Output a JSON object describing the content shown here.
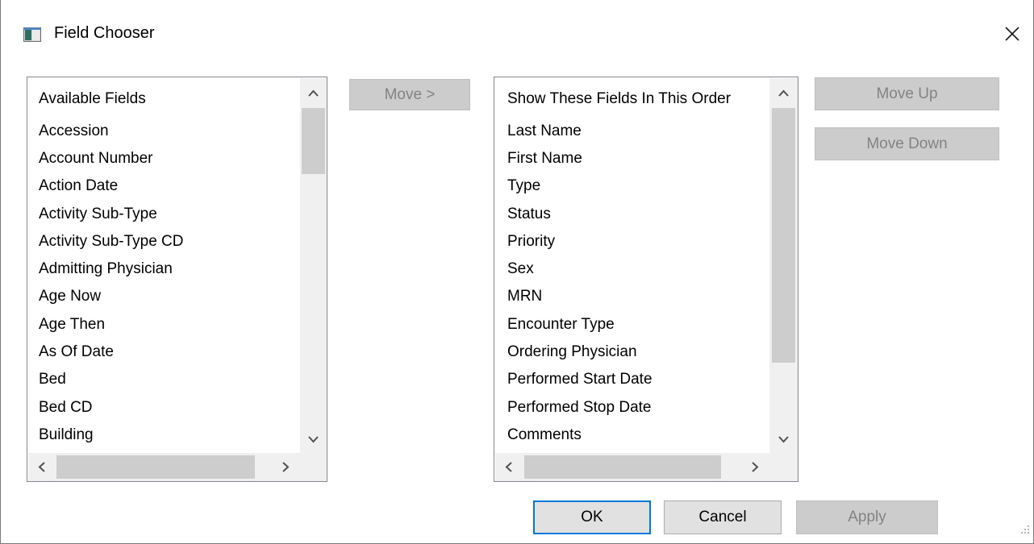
{
  "window": {
    "title": "Field Chooser",
    "icons": {
      "app": "window-app-icon",
      "close": "close-x-icon"
    }
  },
  "available": {
    "header": "Available Fields",
    "items": [
      "Accession",
      "Account Number",
      "Action Date",
      "Activity Sub-Type",
      "Activity Sub-Type CD",
      "Admitting Physician",
      "Age Now",
      "Age Then",
      "As Of Date",
      "Bed",
      "Bed CD",
      "Building"
    ]
  },
  "selected": {
    "header": "Show These Fields In This Order",
    "items": [
      "Last Name",
      "First Name",
      "Type",
      "Status",
      "Priority",
      "Sex",
      "MRN",
      "Encounter Type",
      "Ordering Physician",
      "Performed Start Date",
      "Performed Stop Date",
      "Comments"
    ]
  },
  "buttons": {
    "move": "Move >",
    "move_up": "Move Up",
    "move_down": "Move  Down",
    "ok": "OK",
    "cancel": "Cancel",
    "apply": "Apply"
  },
  "scroll_icons": {
    "up": "chevron-up-icon",
    "down": "chevron-down-icon",
    "left": "chevron-left-icon",
    "right": "chevron-right-icon"
  }
}
